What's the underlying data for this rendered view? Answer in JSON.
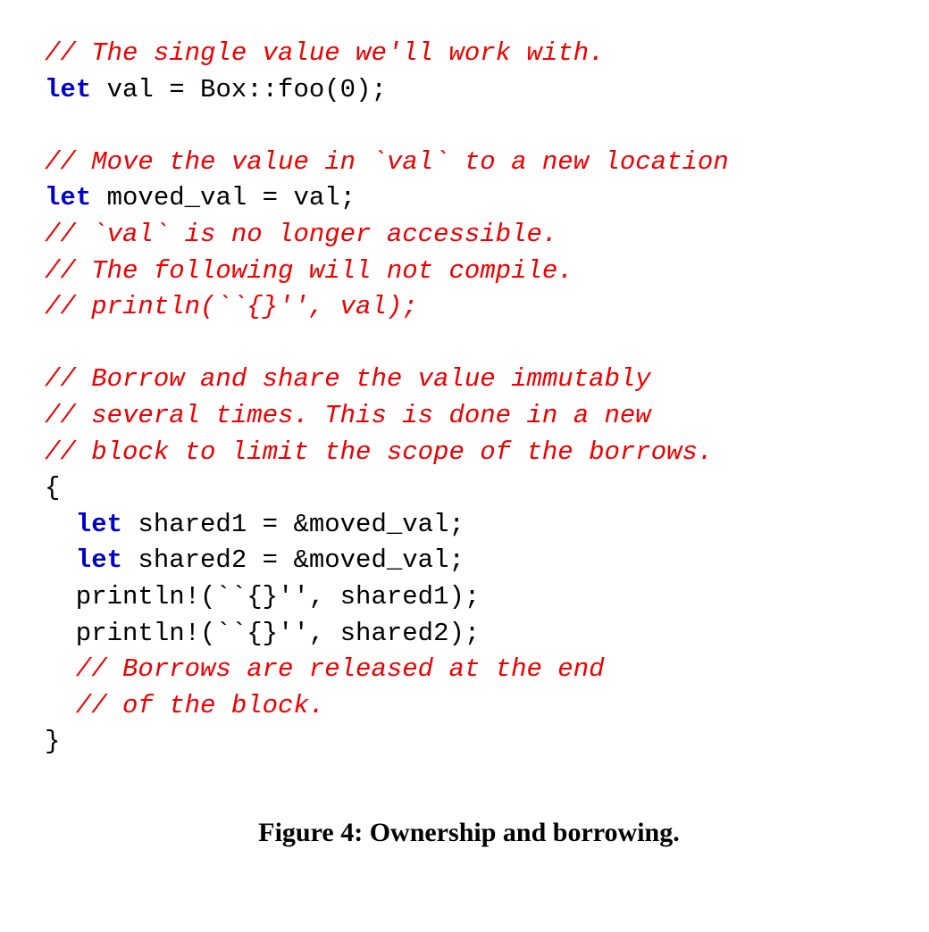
{
  "code": {
    "c1": "// The single value we'll work with.",
    "l1a": "let",
    "l1b": " val = Box::foo(0);",
    "blank1": "",
    "c2": "// Move the value in `val` to a new location",
    "l2a": "let",
    "l2b": " moved_val = val;",
    "c3": "// `val` is no longer accessible.",
    "c4": "// The following will not compile.",
    "c5": "// println(``{}'', val);",
    "blank2": "",
    "c6": "// Borrow and share the value immutably",
    "c7": "// several times. This is done in a new",
    "c8": "// block to limit the scope of the borrows.",
    "l3": "{",
    "l4a": "  let",
    "l4b": " shared1 = &moved_val;",
    "l5a": "  let",
    "l5b": " shared2 = &moved_val;",
    "l6": "  println!(``{}'', shared1);",
    "l7": "  println!(``{}'', shared2);",
    "c9": "  // Borrows are released at the end",
    "c10": "  // of the block.",
    "l8": "}"
  },
  "caption": {
    "label": "Figure 4: ",
    "text": "Ownership and borrowing."
  }
}
